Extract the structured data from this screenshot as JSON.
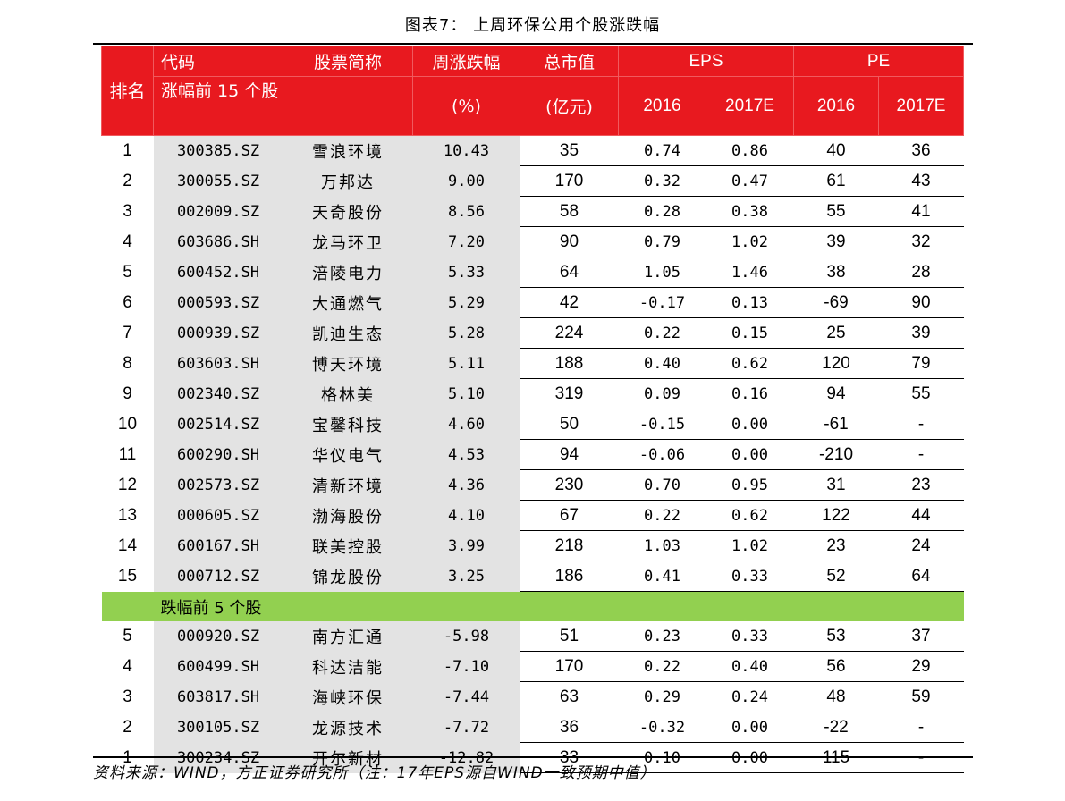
{
  "title": "图表7： 上周环保公用个股涨跌幅",
  "header": {
    "rank": "排名",
    "code": "代码",
    "up_section": "涨幅前 15 个股",
    "name": "股票简称",
    "weekly_change": "周涨跌幅",
    "weekly_change_unit": "(%)",
    "market_cap": "总市值",
    "market_cap_unit": "(亿元)",
    "eps": "EPS",
    "pe": "PE",
    "y2016": "2016",
    "y2017e": "2017E"
  },
  "top_gainers": [
    {
      "rank": "1",
      "code": "300385.SZ",
      "name": "雪浪环境",
      "change": "10.43",
      "mcap": "35",
      "eps16": "0.74",
      "eps17": "0.86",
      "pe16": "40",
      "pe17": "36"
    },
    {
      "rank": "2",
      "code": "300055.SZ",
      "name": "万邦达",
      "change": "9.00",
      "mcap": "170",
      "eps16": "0.32",
      "eps17": "0.47",
      "pe16": "61",
      "pe17": "43"
    },
    {
      "rank": "3",
      "code": "002009.SZ",
      "name": "天奇股份",
      "change": "8.56",
      "mcap": "58",
      "eps16": "0.28",
      "eps17": "0.38",
      "pe16": "55",
      "pe17": "41"
    },
    {
      "rank": "4",
      "code": "603686.SH",
      "name": "龙马环卫",
      "change": "7.20",
      "mcap": "90",
      "eps16": "0.79",
      "eps17": "1.02",
      "pe16": "39",
      "pe17": "32"
    },
    {
      "rank": "5",
      "code": "600452.SH",
      "name": "涪陵电力",
      "change": "5.33",
      "mcap": "64",
      "eps16": "1.05",
      "eps17": "1.46",
      "pe16": "38",
      "pe17": "28"
    },
    {
      "rank": "6",
      "code": "000593.SZ",
      "name": "大通燃气",
      "change": "5.29",
      "mcap": "42",
      "eps16": "-0.17",
      "eps17": "0.13",
      "pe16": "-69",
      "pe17": "90"
    },
    {
      "rank": "7",
      "code": "000939.SZ",
      "name": "凯迪生态",
      "change": "5.28",
      "mcap": "224",
      "eps16": "0.22",
      "eps17": "0.15",
      "pe16": "25",
      "pe17": "39"
    },
    {
      "rank": "8",
      "code": "603603.SH",
      "name": "博天环境",
      "change": "5.11",
      "mcap": "188",
      "eps16": "0.40",
      "eps17": "0.62",
      "pe16": "120",
      "pe17": "79"
    },
    {
      "rank": "9",
      "code": "002340.SZ",
      "name": "格林美",
      "change": "5.10",
      "mcap": "319",
      "eps16": "0.09",
      "eps17": "0.16",
      "pe16": "94",
      "pe17": "55"
    },
    {
      "rank": "10",
      "code": "002514.SZ",
      "name": "宝馨科技",
      "change": "4.60",
      "mcap": "50",
      "eps16": "-0.15",
      "eps17": "0.00",
      "pe16": "-61",
      "pe17": "-"
    },
    {
      "rank": "11",
      "code": "600290.SH",
      "name": "华仪电气",
      "change": "4.53",
      "mcap": "94",
      "eps16": "-0.06",
      "eps17": "0.00",
      "pe16": "-210",
      "pe17": "-"
    },
    {
      "rank": "12",
      "code": "002573.SZ",
      "name": "清新环境",
      "change": "4.36",
      "mcap": "230",
      "eps16": "0.70",
      "eps17": "0.95",
      "pe16": "31",
      "pe17": "23"
    },
    {
      "rank": "13",
      "code": "000605.SZ",
      "name": "渤海股份",
      "change": "4.10",
      "mcap": "67",
      "eps16": "0.22",
      "eps17": "0.62",
      "pe16": "122",
      "pe17": "44"
    },
    {
      "rank": "14",
      "code": "600167.SH",
      "name": "联美控股",
      "change": "3.99",
      "mcap": "218",
      "eps16": "1.03",
      "eps17": "1.02",
      "pe16": "23",
      "pe17": "24"
    },
    {
      "rank": "15",
      "code": "000712.SZ",
      "name": "锦龙股份",
      "change": "3.25",
      "mcap": "186",
      "eps16": "0.41",
      "eps17": "0.33",
      "pe16": "52",
      "pe17": "64"
    }
  ],
  "down_section": "跌幅前 5 个股",
  "top_losers": [
    {
      "rank": "5",
      "code": "000920.SZ",
      "name": "南方汇通",
      "change": "-5.98",
      "mcap": "51",
      "eps16": "0.23",
      "eps17": "0.33",
      "pe16": "53",
      "pe17": "37"
    },
    {
      "rank": "4",
      "code": "600499.SH",
      "name": "科达洁能",
      "change": "-7.10",
      "mcap": "170",
      "eps16": "0.22",
      "eps17": "0.40",
      "pe16": "56",
      "pe17": "29"
    },
    {
      "rank": "3",
      "code": "603817.SH",
      "name": "海峡环保",
      "change": "-7.44",
      "mcap": "63",
      "eps16": "0.29",
      "eps17": "0.24",
      "pe16": "48",
      "pe17": "59"
    },
    {
      "rank": "2",
      "code": "300105.SZ",
      "name": "龙源技术",
      "change": "-7.72",
      "mcap": "36",
      "eps16": "-0.32",
      "eps17": "0.00",
      "pe16": "-22",
      "pe17": "-"
    },
    {
      "rank": "1",
      "code": "300234.SZ",
      "name": "开尔新材",
      "change": "-12.82",
      "mcap": "33",
      "eps16": "0.10",
      "eps17": "0.00",
      "pe16": "115",
      "pe17": "-"
    }
  ],
  "source": "资料来源：WIND，方正证券研究所（注：17年EPS源自WIND一致预期中值）"
}
